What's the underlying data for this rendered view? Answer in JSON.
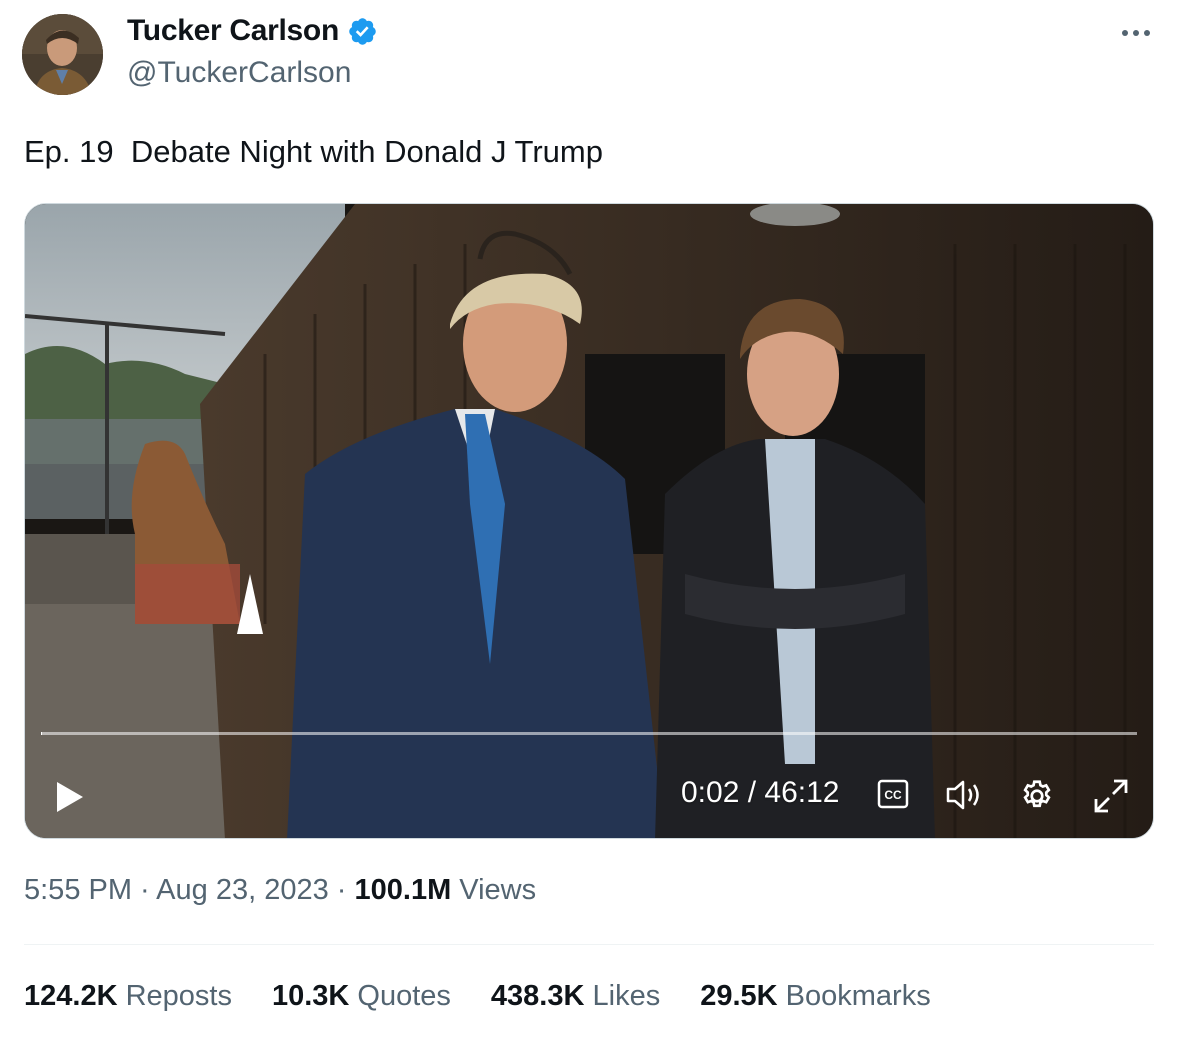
{
  "author": {
    "name": "Tucker Carlson",
    "handle": "@TuckerCarlson",
    "verified": true,
    "avatar_icon": "profile-photo",
    "badge_color": "#1d9bf0"
  },
  "more_icon": "more-horizontal-icon",
  "tweet": {
    "text": "Ep. 19  Debate Night with Donald J Trump"
  },
  "video": {
    "current_time": "0:02",
    "duration": "46:12",
    "time_display": "0:02 / 46:12",
    "progress_fraction": 0.001,
    "controls": [
      "play-icon",
      "captions-icon",
      "volume-icon",
      "settings-icon",
      "fullscreen-icon"
    ],
    "captions_label": "CC"
  },
  "meta": {
    "time": "5:55 PM",
    "sep1": " · ",
    "date": "Aug 23, 2023",
    "sep2": " · ",
    "views_count": "100.1M",
    "views_label": " Views"
  },
  "stats": [
    {
      "count": "124.2K",
      "label": " Reposts"
    },
    {
      "count": "10.3K",
      "label": " Quotes"
    },
    {
      "count": "438.3K",
      "label": " Likes"
    },
    {
      "count": "29.5K",
      "label": " Bookmarks"
    }
  ],
  "colors": {
    "text_primary": "#0f1419",
    "text_secondary": "#536471",
    "divider": "#eff3f4",
    "accent": "#1d9bf0"
  }
}
